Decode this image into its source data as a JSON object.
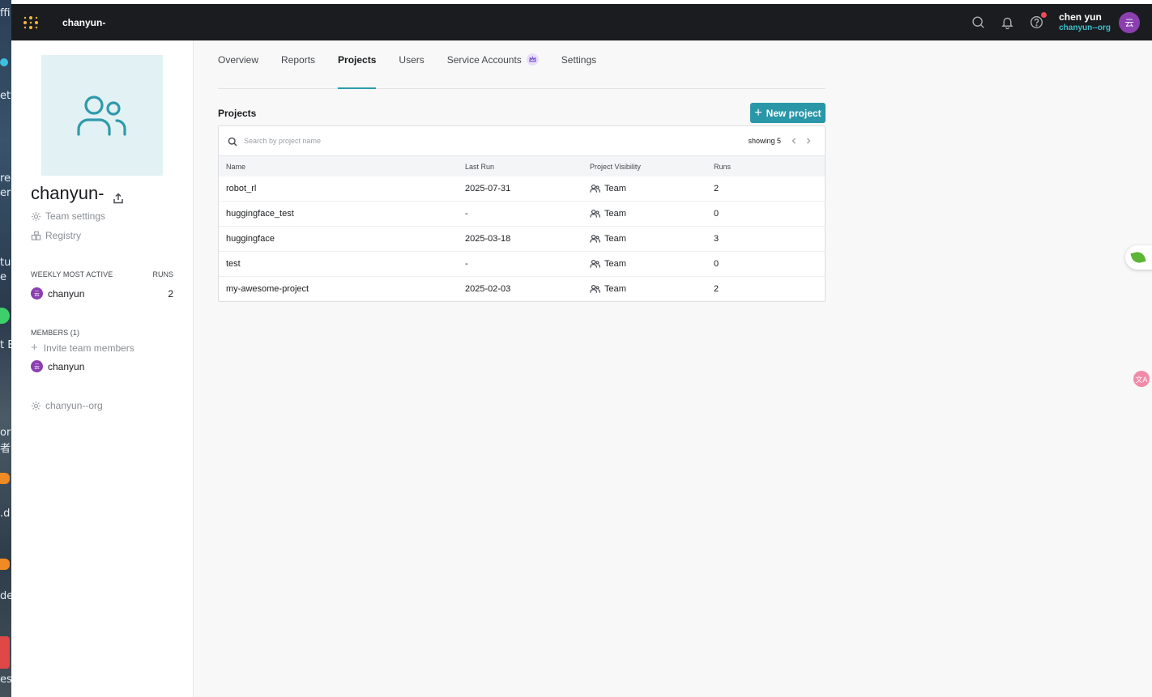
{
  "desktop_fragments": [
    "ffi",
    "ety",
    "ree",
    "er",
    "tu",
    "e",
    "t E",
    "or",
    "者",
    ".d",
    "de",
    "esk"
  ],
  "navbar": {
    "entity": "chanyun-",
    "user_name": "chen yun",
    "user_org": "chanyun--org",
    "avatar_initial": "云"
  },
  "sidebar": {
    "team_name": "chanyun-",
    "team_settings_label": "Team settings",
    "registry_label": "Registry",
    "weekly_head": "WEEKLY MOST ACTIVE",
    "runs_head": "RUNS",
    "weekly_members": [
      {
        "name": "chanyun",
        "runs": "2",
        "initial": "云"
      }
    ],
    "members_head": "MEMBERS (1)",
    "invite_label": "Invite team members",
    "members": [
      {
        "name": "chanyun",
        "initial": "云"
      }
    ],
    "org_label": "chanyun--org"
  },
  "tabs": [
    {
      "label": "Overview",
      "active": false
    },
    {
      "label": "Reports",
      "active": false
    },
    {
      "label": "Projects",
      "active": true
    },
    {
      "label": "Users",
      "active": false
    },
    {
      "label": "Service Accounts",
      "active": false
    },
    {
      "label": "Settings",
      "active": false
    }
  ],
  "projects": {
    "title": "Projects",
    "new_button": "New project",
    "search_placeholder": "Search by project name",
    "showing": "showing 5",
    "columns": [
      "Name",
      "Last Run",
      "Project Visibility",
      "Runs"
    ],
    "rows": [
      {
        "name": "robot_rl",
        "last_run": "2025-07-31",
        "visibility": "Team",
        "runs": "2"
      },
      {
        "name": "huggingface_test",
        "last_run": "-",
        "visibility": "Team",
        "runs": "0"
      },
      {
        "name": "huggingface",
        "last_run": "2025-03-18",
        "visibility": "Team",
        "runs": "3"
      },
      {
        "name": "test",
        "last_run": "-",
        "visibility": "Team",
        "runs": "0"
      },
      {
        "name": "my-awesome-project",
        "last_run": "2025-02-03",
        "visibility": "Team",
        "runs": "2"
      }
    ]
  },
  "floating": {
    "translate_glyph": "文A"
  },
  "colors": {
    "accent": "#2a97a8",
    "nav_bg": "#1a1c1f",
    "org_link": "#3fc1d0",
    "avatar": "#8b3fb0"
  }
}
